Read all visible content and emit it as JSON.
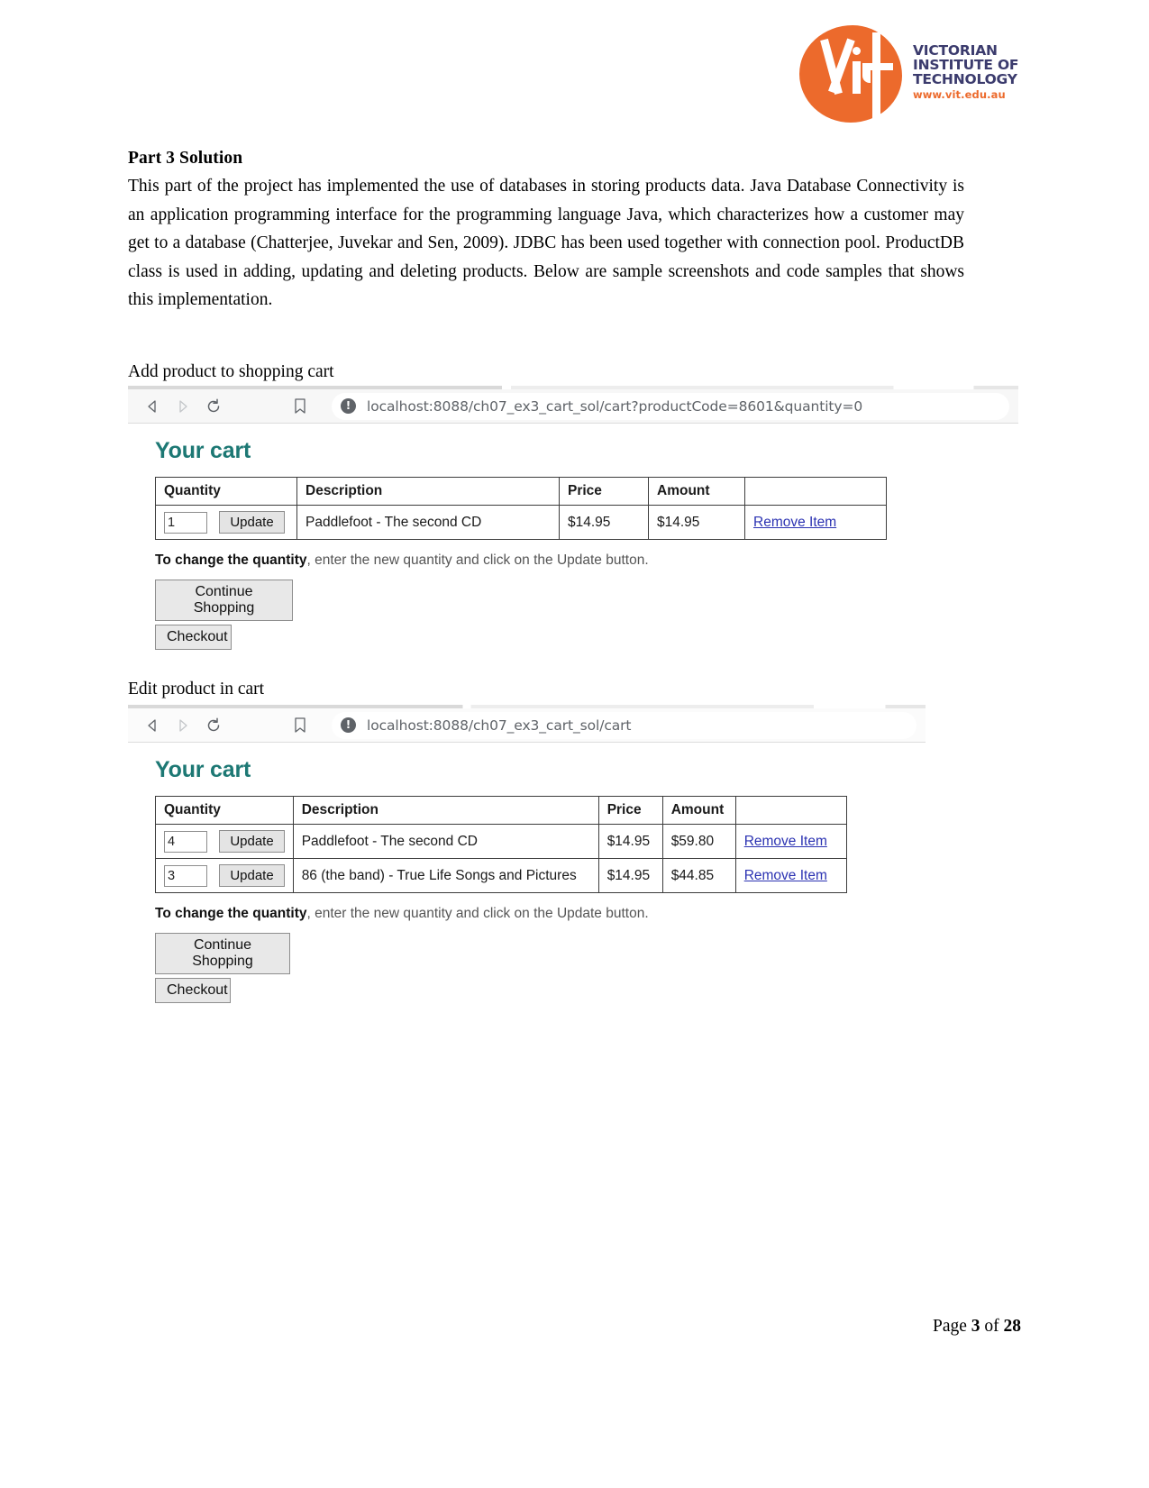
{
  "logo": {
    "line1": "VICTORIAN",
    "line2": "INSTITUTE OF",
    "line3": "TECHNOLOGY",
    "url": "www.vit.edu.au",
    "brand_color": "#ec6a2c",
    "text_color": "#3b3b6d"
  },
  "document": {
    "part_title": "Part 3 Solution",
    "paragraph": "This part of the project has implemented the use of databases in storing products data.  Java Database Connectivity is an application programming interface for the programming language Java, which characterizes how a customer may get to a database (Chatterjee, Juvekar and Sen, 2009). JDBC has been used together with connection pool.  ProductDB class is used in adding, updating and deleting products. Below are sample screenshots and code samples that shows this implementation.",
    "section_1_label": "Add product to shopping cart",
    "section_2_label": "Edit product in cart",
    "footer": {
      "prefix": "Page ",
      "current": "3",
      "middle": " of ",
      "total": "28"
    }
  },
  "screenshot_1": {
    "browser": {
      "back_icon": "back-arrow-icon",
      "forward_icon": "forward-arrow-icon",
      "reload_icon": "reload-icon",
      "bookmark_icon": "bookmark-icon",
      "info_icon": "info-icon",
      "info_glyph": "!",
      "url": "localhost:8088/ch07_ex3_cart_sol/cart?productCode=8601&quantity=0"
    },
    "page": {
      "title": "Your cart",
      "title_color": "#1d7874",
      "columns": [
        "Quantity",
        "Description",
        "Price",
        "Amount",
        ""
      ],
      "rows": [
        {
          "quantity": "1",
          "update_label": "Update",
          "description": "Paddlefoot - The second CD",
          "price": "$14.95",
          "amount": "$14.95",
          "remove_label": "Remove Item"
        }
      ],
      "hint_bold": "To change the quantity",
      "hint_rest": ", enter the new quantity and click on the Update button.",
      "continue_label": "Continue Shopping",
      "checkout_label": "Checkout"
    }
  },
  "screenshot_2": {
    "browser": {
      "back_icon": "back-arrow-icon",
      "forward_icon": "forward-arrow-icon",
      "reload_icon": "reload-icon",
      "bookmark_icon": "bookmark-icon",
      "info_icon": "info-icon",
      "info_glyph": "!",
      "url": "localhost:8088/ch07_ex3_cart_sol/cart"
    },
    "page": {
      "title": "Your cart",
      "title_color": "#1d7874",
      "columns": [
        "Quantity",
        "Description",
        "Price",
        "Amount",
        ""
      ],
      "rows": [
        {
          "quantity": "4",
          "update_label": "Update",
          "description": "Paddlefoot - The second CD",
          "price": "$14.95",
          "amount": "$59.80",
          "remove_label": "Remove Item"
        },
        {
          "quantity": "3",
          "update_label": "Update",
          "description": "86 (the band) - True Life Songs and Pictures",
          "price": "$14.95",
          "amount": "$44.85",
          "remove_label": "Remove Item"
        }
      ],
      "hint_bold": "To change the quantity",
      "hint_rest": ", enter the new quantity and click on the Update button.",
      "continue_label": "Continue Shopping",
      "checkout_label": "Checkout"
    }
  }
}
